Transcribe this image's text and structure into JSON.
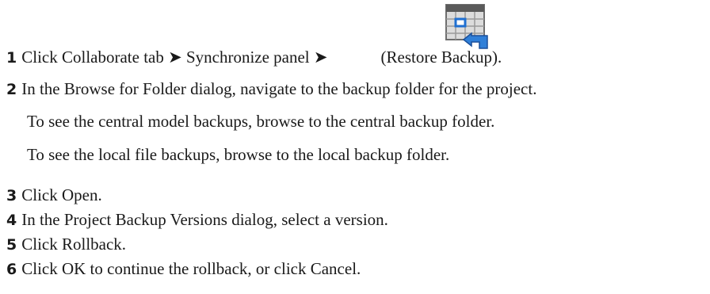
{
  "steps": [
    {
      "number": "1",
      "text_before": "Click Collaborate tab ➤ Synchronize panel ➤",
      "text_after": "(Restore Backup)."
    },
    {
      "number": "2",
      "text": "In the Browse for Folder dialog, navigate to the backup folder for the project."
    },
    {
      "number": "3",
      "text": "Click Open."
    },
    {
      "number": "4",
      "text": "In the Project Backup Versions dialog, select a version."
    },
    {
      "number": "5",
      "text": "Click Rollback."
    },
    {
      "number": "6",
      "text": "Click OK to continue the rollback, or click Cancel."
    }
  ],
  "notes": [
    "To see the central model backups, browse to the central backup folder.",
    "To see the local file backups, browse to the local backup folder."
  ],
  "icon": {
    "name": "restore-backup-icon"
  }
}
